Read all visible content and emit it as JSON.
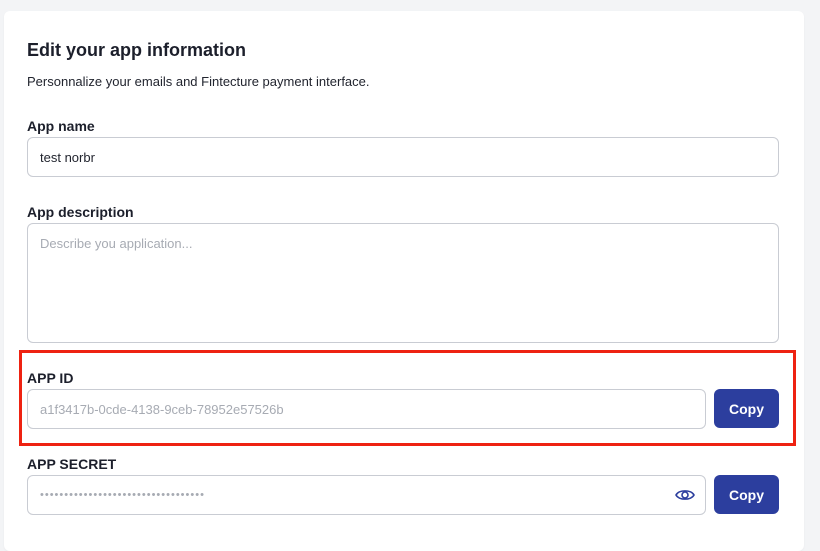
{
  "page": {
    "title": "Edit your app information",
    "subtitle": "Personnalize your emails and Fintecture payment interface."
  },
  "app_name": {
    "label": "App name",
    "value": "test norbr"
  },
  "app_description": {
    "label": "App description",
    "placeholder": "Describe you application..."
  },
  "app_id": {
    "label": "APP ID",
    "value": "a1f3417b-0cde-4138-9ceb-78952e57526b",
    "copy_label": "Copy"
  },
  "app_secret": {
    "label": "APP SECRET",
    "masked_value": "••••••••••••••••••••••••••••••••••",
    "copy_label": "Copy",
    "reveal_icon": "eye-icon"
  },
  "colors": {
    "primary_button": "#2c3e9e",
    "highlight_border": "#ee2211"
  }
}
